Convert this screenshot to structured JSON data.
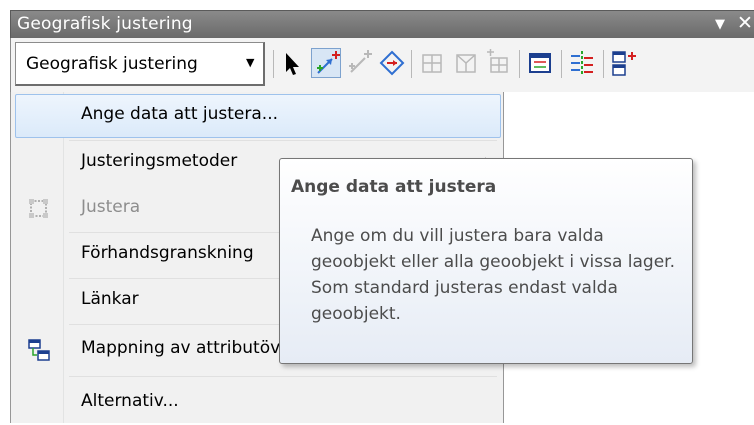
{
  "window": {
    "title": "Geografisk justering"
  },
  "toolbar": {
    "dropdown_label": "Geografisk justering",
    "icons": [
      "select-elements-icon",
      "new-displacement-link-icon",
      "modify-link-icon",
      "multiple-displacement-links-icon",
      "new-identity-link-icon",
      "new-limited-adjustment-area-icon",
      "clear-limited-adjustment-area-icon",
      "view-link-table-icon",
      "edgematch-icon",
      "attribute-transfer-icon"
    ]
  },
  "menu": {
    "items": [
      {
        "label": "Ange data att justera...",
        "state": "highlighted"
      },
      {
        "label": "Justeringsmetoder",
        "state": "normal",
        "submenu": true
      },
      {
        "label": "Justera",
        "state": "disabled",
        "icon": "adjust-icon"
      },
      {
        "label": "Förhandsgranskning",
        "state": "normal"
      },
      {
        "label": "Länkar",
        "state": "normal",
        "submenu": true
      },
      {
        "label": "Mappning av attributöverföring...",
        "state": "normal",
        "icon": "attribute-mapping-icon"
      },
      {
        "label": "Alternativ...",
        "state": "normal"
      }
    ]
  },
  "tooltip": {
    "title": "Ange data att justera",
    "body": "Ange om du vill justera bara valda geoobjekt eller alla geoobjekt i vissa lager. Som standard justeras endast valda geoobjekt."
  },
  "colors": {
    "titlebar": "#7a7a7a",
    "highlight_border": "#9ec2ec",
    "highlight_fill": "#dbeafa",
    "tooltip_text": "#4c4c4c"
  }
}
